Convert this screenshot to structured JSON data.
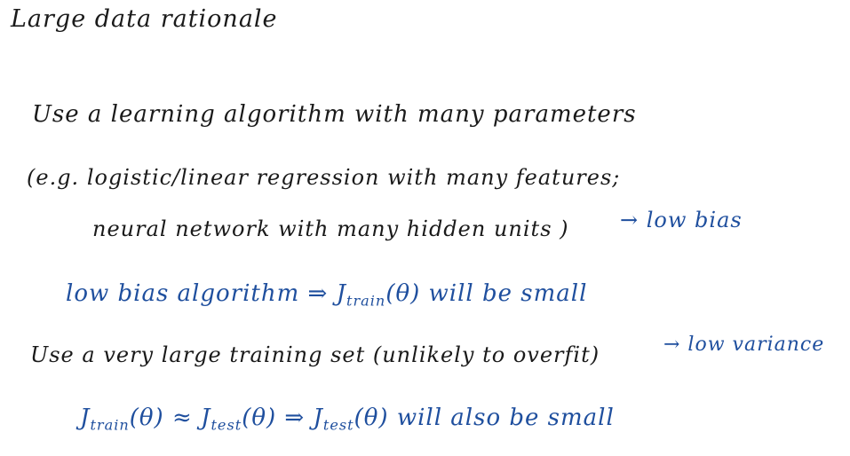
{
  "title": "Large data rationale",
  "lines": {
    "use_many_params": "Use a learning algorithm with many parameters",
    "eg_logistic": "(e.g. logistic/linear regression with many features;",
    "neural_network": "neural network with many hidden units )",
    "low_bias_arrow": "→ low bias",
    "low_bias_algo_prefix": "low bias algorithm ⇒ J",
    "low_bias_algo_sub": "train",
    "low_bias_algo_suffix": "(θ) will be small",
    "large_training_set": "Use a very large training set (unlikely to overfit)",
    "low_variance_arrow": "→ low variance",
    "jtrain_j": "J",
    "jtrain_sub": "train",
    "jtrain_approx": "(θ) ≈ J",
    "jtest_sub": "test",
    "jtest_mid": "(θ) ⇒ J",
    "jtest_sub2": "test",
    "jtest_end": "(θ) will also be small"
  },
  "colors": {
    "ink_black": "#1a1a1a",
    "ink_blue": "#1f4f9e"
  }
}
